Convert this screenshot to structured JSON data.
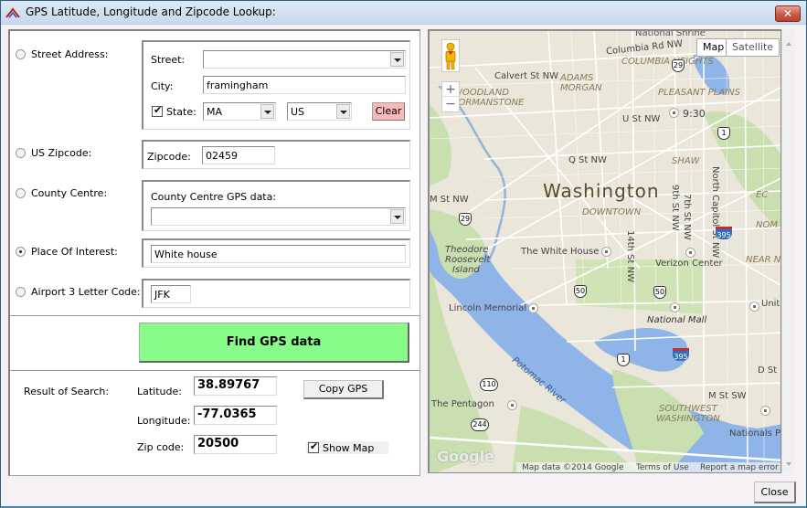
{
  "window": {
    "title": "GPS Latitude, Longitude and Zipcode Lookup:",
    "close_glyph": "✕",
    "close_button_label": "Close"
  },
  "search_options": {
    "selected": "place_of_interest",
    "street_address": {
      "radio_label": "Street Address:",
      "street_label": "Street:",
      "street_value": "",
      "city_label": "City:",
      "city_value": "framingham",
      "state_checkbox_checked": true,
      "state_label": "State:",
      "state_value": "MA",
      "country_value": "US",
      "clear_label": "Clear"
    },
    "us_zipcode": {
      "radio_label": "US Zipcode:",
      "zipcode_label": "Zipcode:",
      "zipcode_value": "02459"
    },
    "county_centre": {
      "radio_label": "County Centre:",
      "field_label": "County Centre GPS data:",
      "value": ""
    },
    "place_of_interest": {
      "radio_label": "Place Of Interest:",
      "value": "White house"
    },
    "airport": {
      "radio_label": "Airport 3 Letter Code:",
      "value": "JFK"
    }
  },
  "find_button_label": "Find GPS data",
  "results": {
    "section_label": "Result of Search:",
    "latitude_label": "Latitude:",
    "latitude_value": "38.89767",
    "longitude_label": "Longitude:",
    "longitude_value": "-77.0365",
    "zip_label": "Zip code:",
    "zip_value": "20500",
    "copy_gps_label": "Copy GPS",
    "show_map_label": "Show Map",
    "show_map_checked": true
  },
  "map": {
    "type_map_label": "Map",
    "type_satellite_label": "Satellite",
    "zoom_in": "+",
    "zoom_out": "−",
    "city_label": "Washington",
    "labels": {
      "national_shrine": "National Shrine",
      "columbia_rd": "Columbia Rd NW",
      "columbia_heights": "COLUMBIA HEIGHTS",
      "calvert": "Calvert St NW",
      "adams_morgan": "ADAMS MORGAN",
      "woodland": "WOODLAND",
      "normanstone": "NORMANSTONE",
      "pleasant_plains": "PLEASANT PLAINS",
      "nine_thirty": "9:30",
      "u_st": "U St NW",
      "q_st": "Q St NW",
      "shaw": "SHAW",
      "north_capitol": "North Capitol St NW",
      "nom": "NOM",
      "m_st_nw": "M St NW",
      "downtown": "DOWNTOWN",
      "ninth_st": "9th St NW",
      "seventh_st": "7th St NW",
      "near_ne": "NEAR NO",
      "theodore": "Theodore",
      "roosevelt": "Roosevelt",
      "island": "Island",
      "white_house": "The White House",
      "fourteenth": "14th St NW",
      "verizon": "Verizon Center",
      "lincoln": "Lincoln Memorial",
      "national_mall": "National Mall",
      "united": "Unite",
      "potomac": "Potomac River",
      "d_st": "D St S",
      "m_st_sw": "M St SW",
      "southwest": "SOUTHWEST",
      "washington_sw": "WASHINGTON",
      "pentagon": "The Pentagon",
      "nationals": "Nationals Pa",
      "ec": "EC"
    },
    "shields": {
      "us29_top": "29",
      "us29": "29",
      "us1_top": "1",
      "us1": "1",
      "us50_a": "50",
      "us50_b": "50",
      "i395_a": "395",
      "i395_b": "395",
      "r110": "110",
      "r244": "244"
    },
    "attribution": "Map data ©2014 Google",
    "terms": "Terms of Use",
    "report": "Report a map error",
    "google_logo": "Google"
  }
}
